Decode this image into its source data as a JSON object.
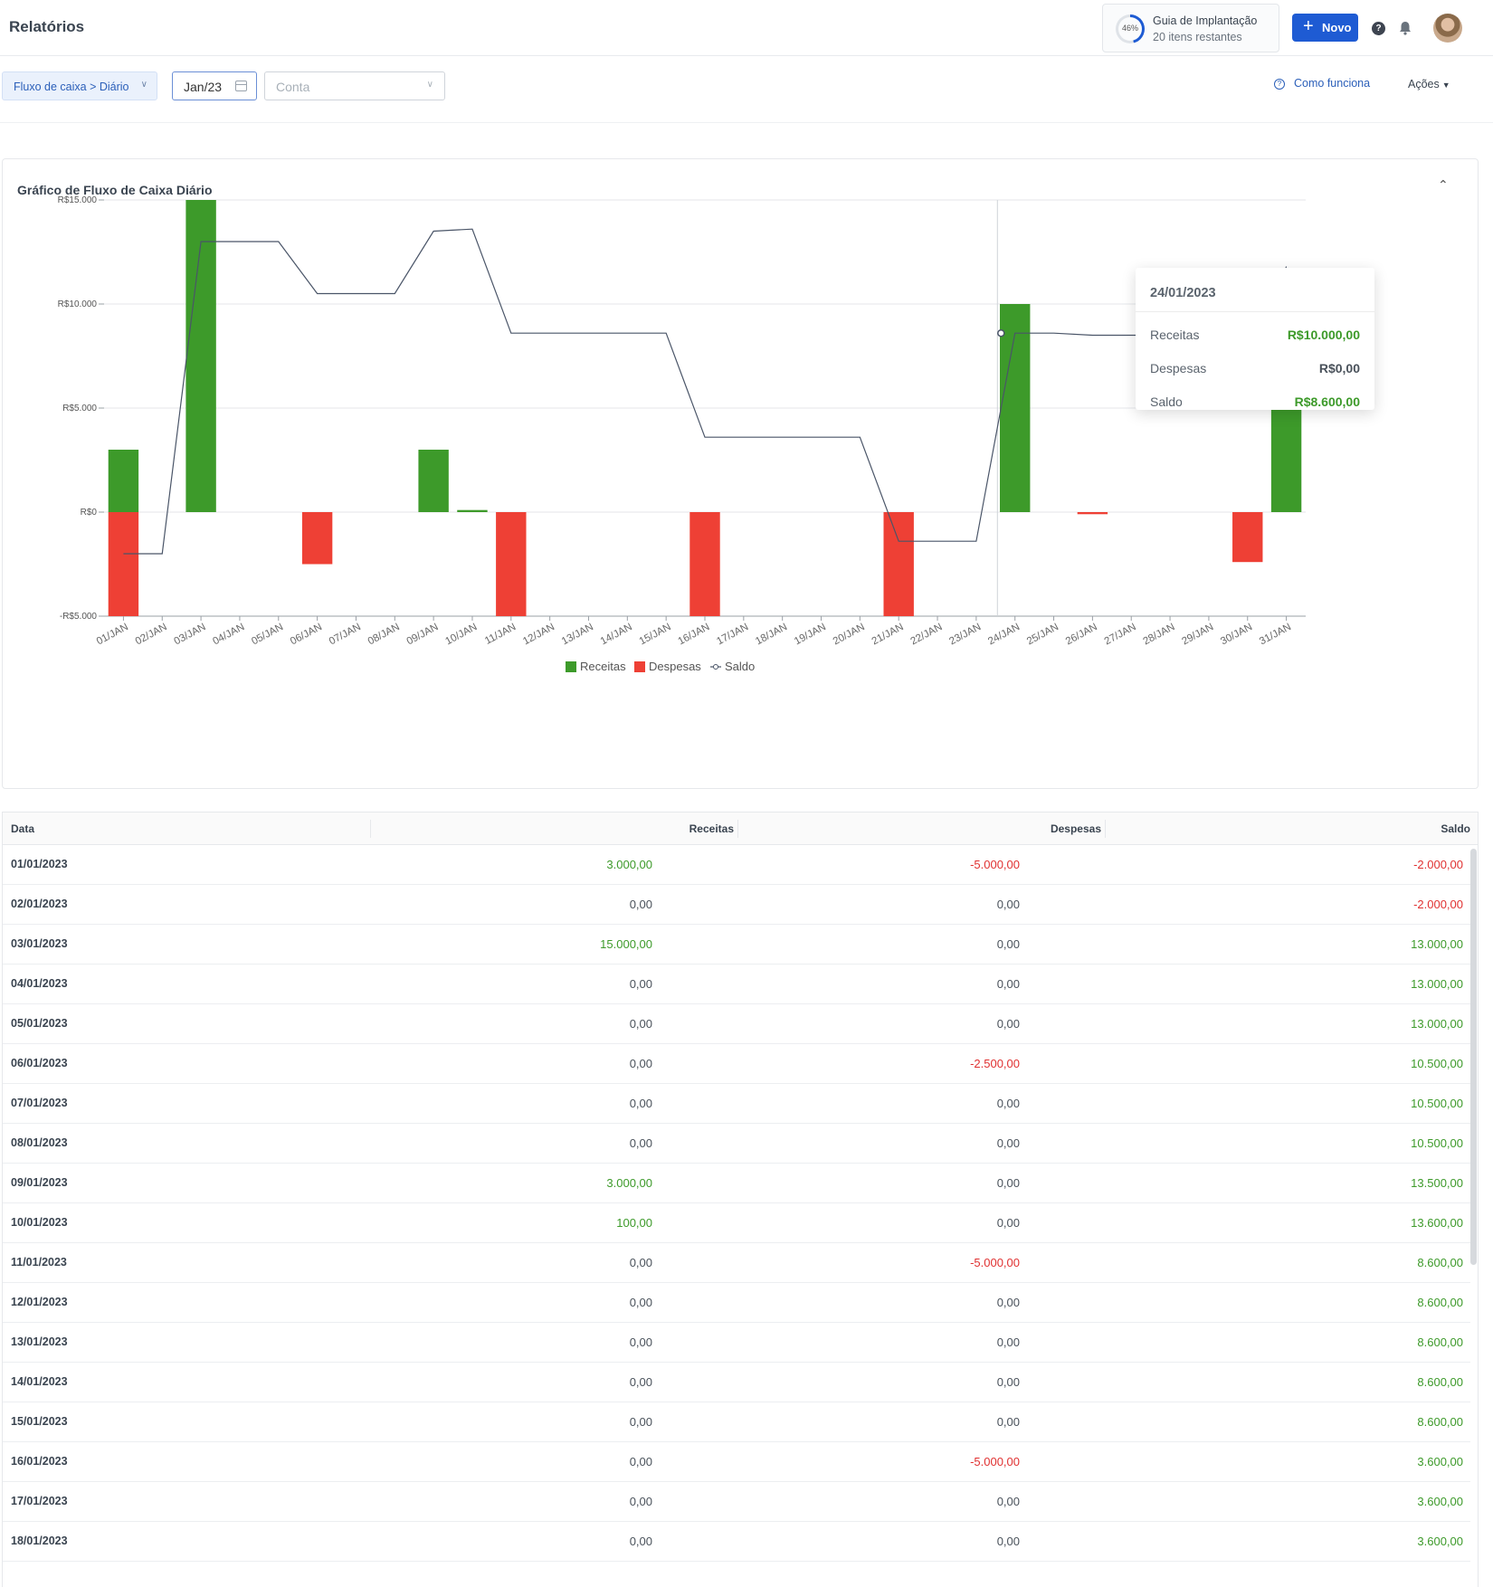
{
  "header": {
    "title": "Relatórios",
    "guide": {
      "percent_label": "46%",
      "progress": 0.46,
      "title": "Guia de Implantação",
      "subtitle": "20 itens restantes"
    },
    "new_button": "Novo",
    "help_glyph": "?",
    "icons": [
      "help-icon",
      "bell-icon",
      "avatar"
    ]
  },
  "filters": {
    "report_select": "Fluxo de caixa > Diário",
    "date_value": "Jan/23",
    "account_placeholder": "Conta",
    "how_it_works": "Como funciona",
    "actions": "Ações"
  },
  "chart_section": {
    "title": "Gráfico de Fluxo de Caixa Diário",
    "tooltip": {
      "date": "24/01/2023",
      "rows": [
        {
          "label": "Receitas",
          "value": "R$10.000,00",
          "tone": "pos"
        },
        {
          "label": "Despesas",
          "value": "R$0,00",
          "tone": "zero"
        },
        {
          "label": "Saldo",
          "value": "R$8.600,00",
          "tone": "pos"
        }
      ]
    }
  },
  "chart_data": {
    "type": "bar",
    "title": "Gráfico de Fluxo de Caixa Diário",
    "ylim": [
      -5000,
      15000
    ],
    "y_ticks": [
      15000,
      10000,
      5000,
      0,
      -5000
    ],
    "y_tick_labels": [
      "R$15.000",
      "R$10.000",
      "R$5.000",
      "R$0",
      "-R$5.000"
    ],
    "categories": [
      "01/JAN",
      "02/JAN",
      "03/JAN",
      "04/JAN",
      "05/JAN",
      "06/JAN",
      "07/JAN",
      "08/JAN",
      "09/JAN",
      "10/JAN",
      "11/JAN",
      "12/JAN",
      "13/JAN",
      "14/JAN",
      "15/JAN",
      "16/JAN",
      "17/JAN",
      "18/JAN",
      "19/JAN",
      "20/JAN",
      "21/JAN",
      "22/JAN",
      "23/JAN",
      "24/JAN",
      "25/JAN",
      "26/JAN",
      "27/JAN",
      "28/JAN",
      "29/JAN",
      "30/JAN",
      "31/JAN"
    ],
    "series": [
      {
        "name": "Receitas",
        "type": "bar",
        "color": "#3d9a2a",
        "values": [
          3000,
          0,
          15000,
          0,
          0,
          0,
          0,
          0,
          3000,
          100,
          0,
          0,
          0,
          0,
          0,
          0,
          0,
          0,
          0,
          0,
          0,
          0,
          0,
          10000,
          0,
          0,
          0,
          0,
          0,
          0,
          5700
        ]
      },
      {
        "name": "Despesas",
        "type": "bar",
        "color": "#ee4035",
        "values": [
          -5000,
          0,
          0,
          0,
          0,
          -2500,
          0,
          0,
          0,
          0,
          -5000,
          0,
          0,
          0,
          0,
          -5000,
          0,
          0,
          0,
          0,
          -5000,
          0,
          0,
          0,
          0,
          -100,
          0,
          0,
          0,
          -2400,
          0
        ]
      },
      {
        "name": "Saldo",
        "type": "line",
        "color": "#4a5568",
        "values": [
          -2000,
          -2000,
          13000,
          13000,
          13000,
          10500,
          10500,
          10500,
          13500,
          13600,
          8600,
          8600,
          8600,
          8600,
          8600,
          3600,
          3600,
          3600,
          3600,
          3600,
          -1400,
          -1400,
          -1400,
          8600,
          8600,
          8500,
          8500,
          8500,
          8500,
          6100,
          11800
        ]
      }
    ],
    "highlight_index": 23,
    "legend_placement": "bottom-center",
    "grid": true
  },
  "table": {
    "headers": {
      "date": "Data",
      "receitas": "Receitas",
      "despesas": "Despesas",
      "saldo": "Saldo"
    },
    "rows": [
      {
        "date": "01/01/2023",
        "receitas": "3.000,00",
        "despesas": "-5.000,00",
        "saldo": "-2.000,00"
      },
      {
        "date": "02/01/2023",
        "receitas": "0,00",
        "despesas": "0,00",
        "saldo": "-2.000,00"
      },
      {
        "date": "03/01/2023",
        "receitas": "15.000,00",
        "despesas": "0,00",
        "saldo": "13.000,00"
      },
      {
        "date": "04/01/2023",
        "receitas": "0,00",
        "despesas": "0,00",
        "saldo": "13.000,00"
      },
      {
        "date": "05/01/2023",
        "receitas": "0,00",
        "despesas": "0,00",
        "saldo": "13.000,00"
      },
      {
        "date": "06/01/2023",
        "receitas": "0,00",
        "despesas": "-2.500,00",
        "saldo": "10.500,00"
      },
      {
        "date": "07/01/2023",
        "receitas": "0,00",
        "despesas": "0,00",
        "saldo": "10.500,00"
      },
      {
        "date": "08/01/2023",
        "receitas": "0,00",
        "despesas": "0,00",
        "saldo": "10.500,00"
      },
      {
        "date": "09/01/2023",
        "receitas": "3.000,00",
        "despesas": "0,00",
        "saldo": "13.500,00"
      },
      {
        "date": "10/01/2023",
        "receitas": "100,00",
        "despesas": "0,00",
        "saldo": "13.600,00"
      },
      {
        "date": "11/01/2023",
        "receitas": "0,00",
        "despesas": "-5.000,00",
        "saldo": "8.600,00"
      },
      {
        "date": "12/01/2023",
        "receitas": "0,00",
        "despesas": "0,00",
        "saldo": "8.600,00"
      },
      {
        "date": "13/01/2023",
        "receitas": "0,00",
        "despesas": "0,00",
        "saldo": "8.600,00"
      },
      {
        "date": "14/01/2023",
        "receitas": "0,00",
        "despesas": "0,00",
        "saldo": "8.600,00"
      },
      {
        "date": "15/01/2023",
        "receitas": "0,00",
        "despesas": "0,00",
        "saldo": "8.600,00"
      },
      {
        "date": "16/01/2023",
        "receitas": "0,00",
        "despesas": "-5.000,00",
        "saldo": "3.600,00"
      },
      {
        "date": "17/01/2023",
        "receitas": "0,00",
        "despesas": "0,00",
        "saldo": "3.600,00"
      },
      {
        "date": "18/01/2023",
        "receitas": "0,00",
        "despesas": "0,00",
        "saldo": "3.600,00"
      }
    ]
  }
}
